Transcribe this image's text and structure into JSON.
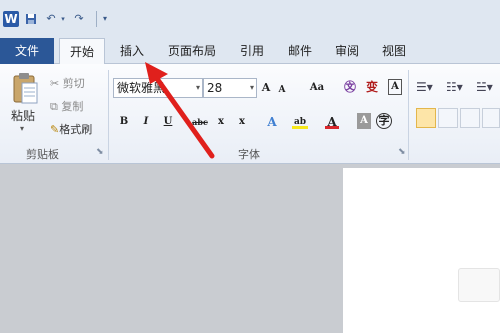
{
  "quick_access": {
    "word_icon": "W",
    "save_icon": "save-icon",
    "undo_icon": "undo-icon",
    "redo_icon": "redo-icon",
    "customize_icon": "customize-qat-icon"
  },
  "tabs": [
    {
      "label": "文件"
    },
    {
      "label": "开始"
    },
    {
      "label": "插入"
    },
    {
      "label": "页面布局"
    },
    {
      "label": "引用"
    },
    {
      "label": "邮件"
    },
    {
      "label": "审阅"
    },
    {
      "label": "视图"
    }
  ],
  "clipboard": {
    "paste": "粘贴",
    "cut": "剪切",
    "copy": "复制",
    "format_painter": "格式刷",
    "group_label": "剪贴板"
  },
  "font": {
    "font_name": "微软雅黑",
    "font_size": "28",
    "group_label": "字体",
    "grow": "A",
    "shrink": "A",
    "change_case": "Aa",
    "pinyin": "㉆",
    "phonetic": "变",
    "border": "A",
    "bold": "B",
    "italic": "I",
    "underline": "U",
    "strike": "abc",
    "subscript": "x",
    "superscript": "x",
    "effects": "A",
    "highlight": "ab",
    "font_color": "A",
    "shading": "A",
    "enclose": "字"
  },
  "colors": {
    "file_tab": "#2b5797",
    "arrow": "#e0201c",
    "highlight": "#f7e81a",
    "font_color": "#d8262b"
  }
}
